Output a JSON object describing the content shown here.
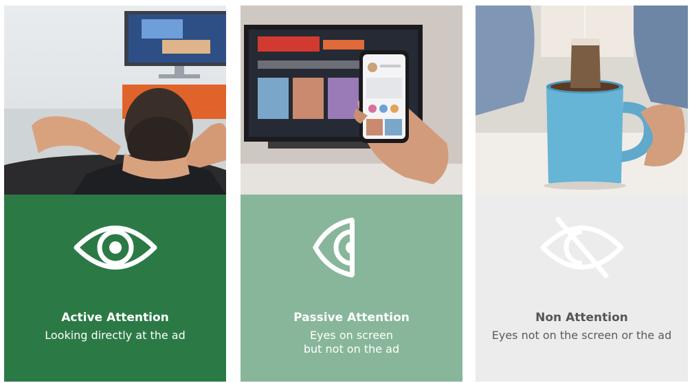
{
  "panels": [
    {
      "photo_subject": "man-relaxing-watching-tv",
      "icon": "eye-icon",
      "title": "Active Attention",
      "description_lines": [
        "Looking directly at the ad"
      ],
      "color": "#2b7a45"
    },
    {
      "photo_subject": "phone-in-front-of-tv",
      "icon": "half-eye-icon",
      "title": "Passive Attention",
      "description_lines": [
        "Eyes on screen",
        "but not on the ad"
      ],
      "color": "#88b69a"
    },
    {
      "photo_subject": "hand-holding-tea-mug",
      "icon": "eye-slash-icon",
      "title": "Non Attention",
      "description_lines": [
        "Eyes not on the screen or the ad"
      ],
      "color": "#ececec"
    }
  ]
}
